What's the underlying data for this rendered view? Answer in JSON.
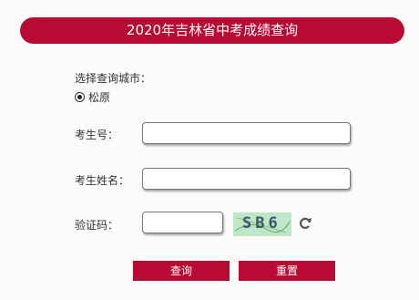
{
  "header": {
    "title": "2020年吉林省中考成绩查询"
  },
  "city": {
    "label": "选择查询城市：",
    "options": [
      "松原"
    ],
    "selected": "松原"
  },
  "form": {
    "exam_no_label": "考生号：",
    "exam_no_value": "",
    "name_label": "考生姓名：",
    "name_value": "",
    "captcha_label": "验证码：",
    "captcha_value": "",
    "captcha_image_text": "SB6"
  },
  "buttons": {
    "query": "查询",
    "reset": "重置"
  },
  "colors": {
    "accent": "#b70b33",
    "captcha_bg": "#bfe6c6"
  },
  "icons": {
    "refresh": "refresh-icon",
    "radio": "radio-selected-icon"
  }
}
